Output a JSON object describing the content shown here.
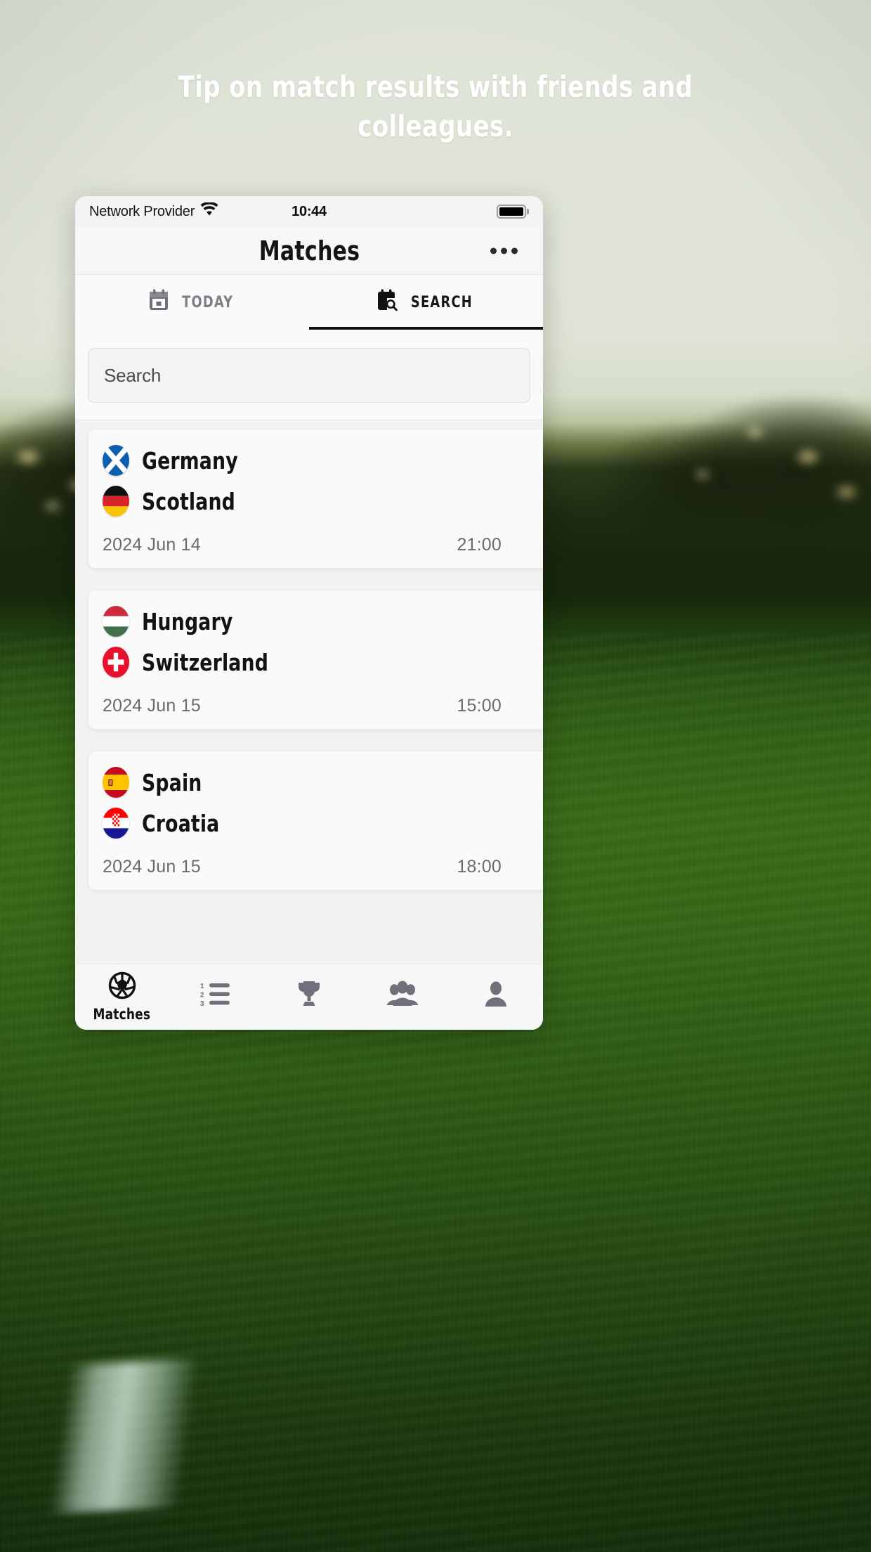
{
  "headline": "Tip on match results with friends and colleagues.",
  "status_bar": {
    "carrier": "Network Provider",
    "wifi_icon": "wifi-icon",
    "time": "10:44",
    "battery_icon": "battery-full-icon"
  },
  "app_bar": {
    "title": "Matches",
    "overflow_icon": "more-horizontal-icon"
  },
  "tabs": [
    {
      "label": "TODAY",
      "icon": "calendar-icon",
      "active": false
    },
    {
      "label": "SEARCH",
      "icon": "calendar-search-icon",
      "active": true
    }
  ],
  "search": {
    "placeholder": "Search",
    "value": ""
  },
  "matches": [
    {
      "home": {
        "name": "Germany",
        "flag": "scotland-flag-icon"
      },
      "away": {
        "name": "Scotland",
        "flag": "germany-flag-icon"
      },
      "date": "2024 Jun 14",
      "time": "21:00"
    },
    {
      "home": {
        "name": "Hungary",
        "flag": "hungary-flag-icon"
      },
      "away": {
        "name": "Switzerland",
        "flag": "switzerland-flag-icon"
      },
      "date": "2024 Jun 15",
      "time": "15:00"
    },
    {
      "home": {
        "name": "Spain",
        "flag": "spain-flag-icon"
      },
      "away": {
        "name": "Croatia",
        "flag": "croatia-flag-icon"
      },
      "date": "2024 Jun 15",
      "time": "18:00"
    }
  ],
  "bottom_nav": [
    {
      "label": "Matches",
      "icon": "soccer-ball-icon",
      "active": true
    },
    {
      "label": "",
      "icon": "ranking-list-icon",
      "active": false
    },
    {
      "label": "",
      "icon": "trophy-icon",
      "active": false
    },
    {
      "label": "",
      "icon": "group-people-icon",
      "active": false
    },
    {
      "label": "",
      "icon": "person-icon",
      "active": false
    }
  ],
  "colors": {
    "accent": "#111114",
    "inactive": "#70707a",
    "card_bg": "#fafafa",
    "screen_bg": "#f2f2f2",
    "headline_text": "#ffffff"
  }
}
